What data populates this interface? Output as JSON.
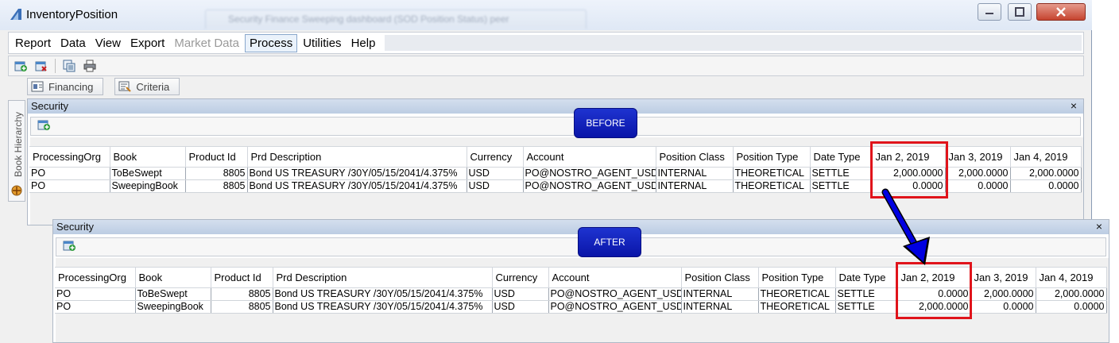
{
  "window": {
    "title": "InventoryPosition",
    "background_tab": "Security Finance Sweeping dashboard (SOD Position Status) peer"
  },
  "menu": [
    {
      "label": "Report",
      "state": "normal"
    },
    {
      "label": "Data",
      "state": "normal"
    },
    {
      "label": "View",
      "state": "normal"
    },
    {
      "label": "Export",
      "state": "normal"
    },
    {
      "label": "Market Data",
      "state": "disabled"
    },
    {
      "label": "Process",
      "state": "active"
    },
    {
      "label": "Utilities",
      "state": "normal"
    },
    {
      "label": "Help",
      "state": "normal"
    }
  ],
  "tabs": {
    "financing": "Financing",
    "criteria": "Criteria"
  },
  "side_panel": {
    "label": "Book Hierarchy"
  },
  "before": {
    "title": "Security",
    "close": "×",
    "badge": "BEFORE",
    "columns": [
      "ProcessingOrg",
      "Book",
      "Product Id",
      "Prd Description",
      "Currency",
      "Account",
      "Position Class",
      "Position Type",
      "Date Type",
      "Jan 2, 2019",
      "Jan 3, 2019",
      "Jan 4, 2019"
    ],
    "rows": [
      [
        "PO",
        "ToBeSwept",
        "8805",
        "Bond US TREASURY /30Y/05/15/2041/4.375%",
        "USD",
        "PO@NOSTRO_AGENT_USD",
        "INTERNAL",
        "THEORETICAL",
        "SETTLE",
        "2,000.0000",
        "2,000.0000",
        "2,000.0000"
      ],
      [
        "PO",
        "SweepingBook",
        "8805",
        "Bond US TREASURY /30Y/05/15/2041/4.375%",
        "USD",
        "PO@NOSTRO_AGENT_USD",
        "INTERNAL",
        "THEORETICAL",
        "SETTLE",
        "0.0000",
        "0.0000",
        "0.0000"
      ]
    ]
  },
  "after": {
    "title": "Security",
    "close": "×",
    "badge": "AFTER",
    "columns": [
      "ProcessingOrg",
      "Book",
      "Product Id",
      "Prd Description",
      "Currency",
      "Account",
      "Position Class",
      "Position Type",
      "Date Type",
      "Jan 2, 2019",
      "Jan 3, 2019",
      "Jan 4, 2019"
    ],
    "rows": [
      [
        "PO",
        "ToBeSwept",
        "8805",
        "Bond US TREASURY /30Y/05/15/2041/4.375%",
        "USD",
        "PO@NOSTRO_AGENT_USD",
        "INTERNAL",
        "THEORETICAL",
        "SETTLE",
        "0.0000",
        "2,000.0000",
        "2,000.0000"
      ],
      [
        "PO",
        "SweepingBook",
        "8805",
        "Bond US TREASURY /30Y/05/15/2041/4.375%",
        "USD",
        "PO@NOSTRO_AGENT_USD",
        "INTERNAL",
        "THEORETICAL",
        "SETTLE",
        "2,000.0000",
        "0.0000",
        "0.0000"
      ]
    ]
  },
  "colors": {
    "highlight": "#e0141b",
    "badge": "#0a15a8",
    "arrow": "#0000e0",
    "panel_header": "#c6d5e9"
  },
  "icons": [
    "app-logo-icon",
    "minimize-icon",
    "maximize-icon",
    "close-icon",
    "add-row-icon",
    "delete-row-icon",
    "copy-icon",
    "print-icon",
    "financing-icon",
    "criteria-icon",
    "hierarchy-icon",
    "sweep-arrow-icon"
  ]
}
